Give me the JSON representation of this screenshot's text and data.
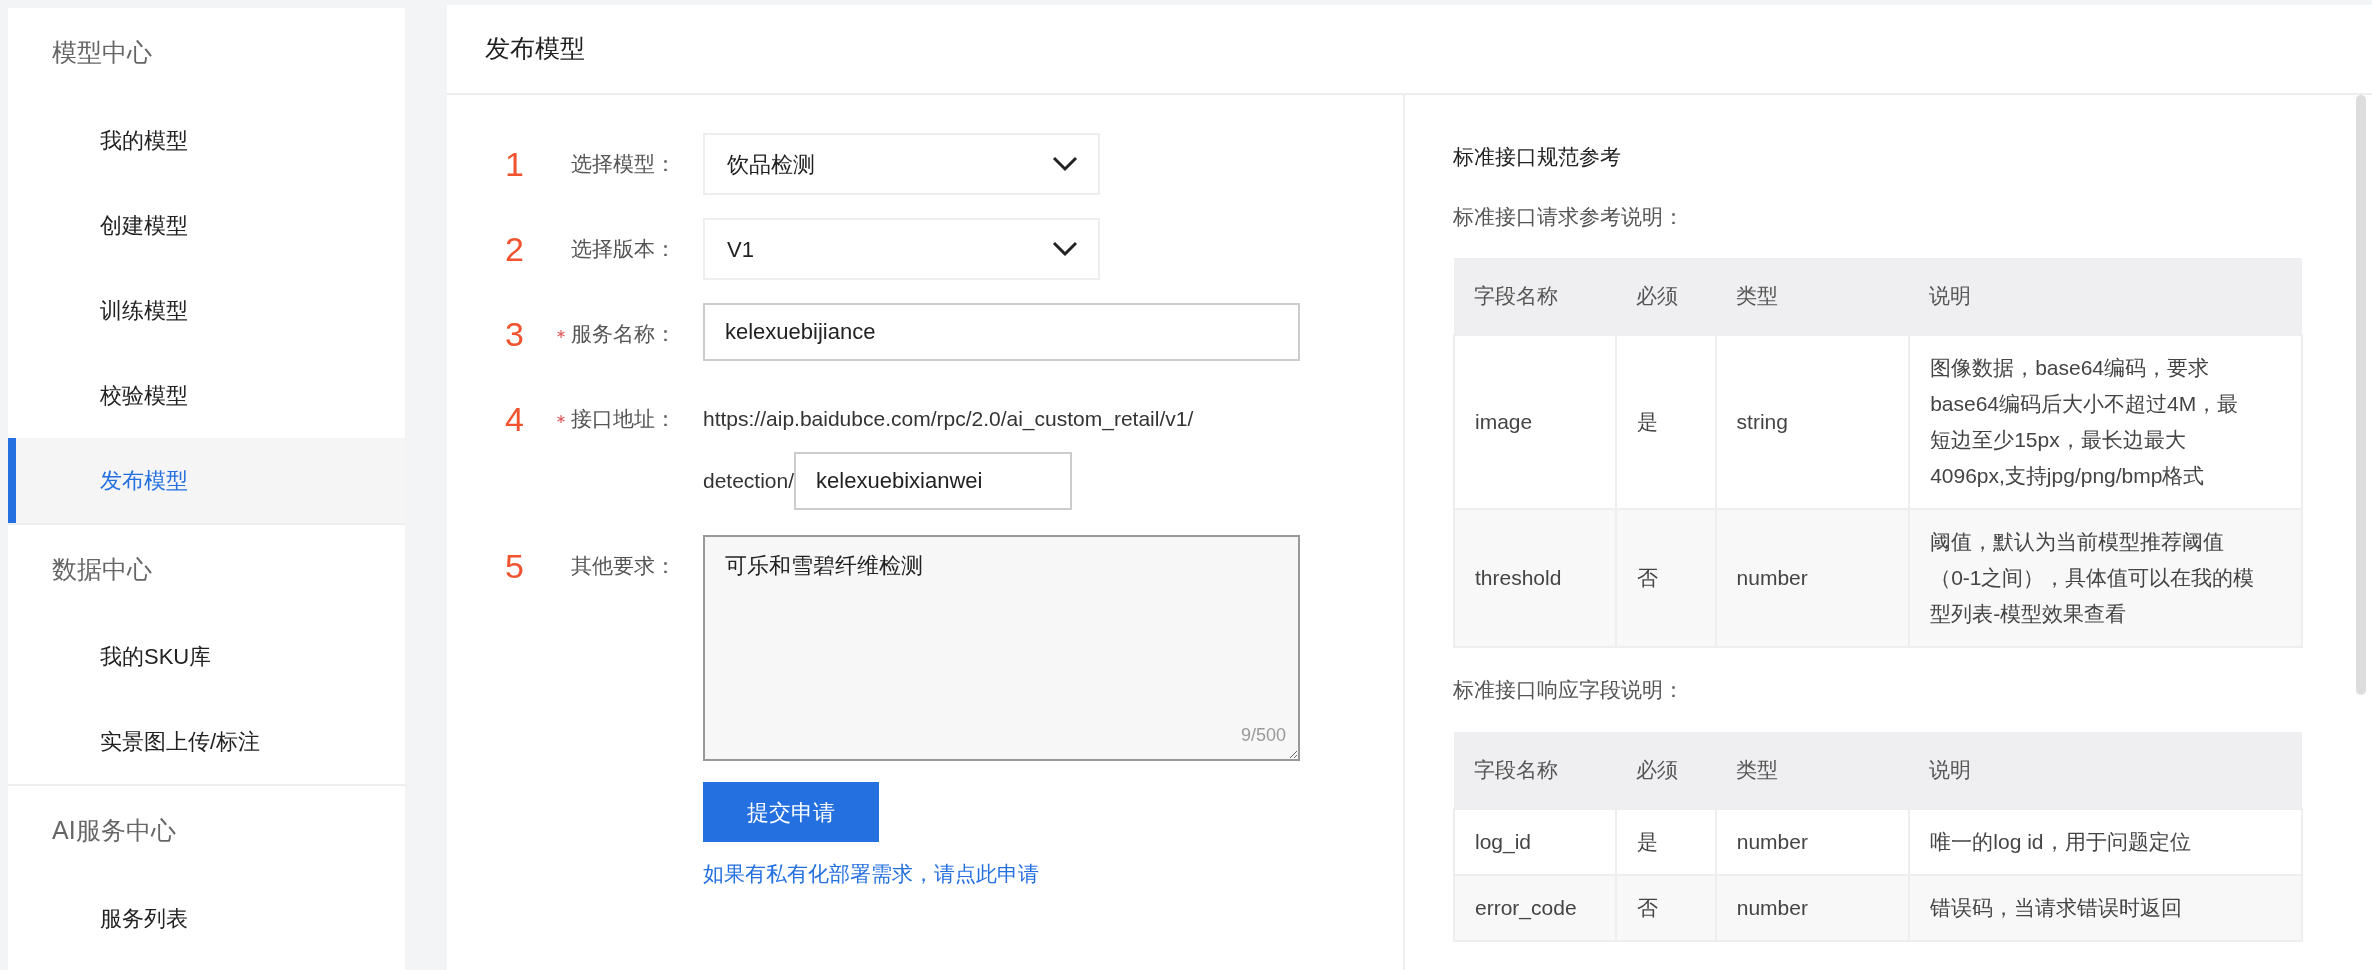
{
  "sidebar": {
    "groups": [
      {
        "title": "模型中心",
        "items": [
          {
            "label": "我的模型",
            "selected": false
          },
          {
            "label": "创建模型",
            "selected": false
          },
          {
            "label": "训练模型",
            "selected": false
          },
          {
            "label": "校验模型",
            "selected": false
          },
          {
            "label": "发布模型",
            "selected": true
          }
        ]
      },
      {
        "title": "数据中心",
        "items": [
          {
            "label": "我的SKU库",
            "selected": false
          },
          {
            "label": "实景图上传/标注",
            "selected": false
          }
        ]
      },
      {
        "title": "AI服务中心",
        "items": [
          {
            "label": "服务列表",
            "selected": false
          }
        ]
      }
    ]
  },
  "main": {
    "title": "发布模型",
    "form": {
      "fields": [
        {
          "kind": "select",
          "step": "1",
          "label": "选择模型：",
          "required": false,
          "value": "饮品检测"
        },
        {
          "kind": "select",
          "step": "2",
          "label": "选择版本：",
          "required": false,
          "value": "V1"
        },
        {
          "kind": "input",
          "step": "3",
          "label": "服务名称：",
          "required": true,
          "value": "kelexuebijiance"
        },
        {
          "kind": "address",
          "step": "4",
          "label": "接口地址：",
          "required": true,
          "url_line": "https://aip.baidubce.com/rpc/2.0/ai_custom_retail/v1/",
          "url_prefix": "detection/",
          "value": "kelexuebixianwei"
        },
        {
          "kind": "textarea",
          "step": "5",
          "label": "其他要求：",
          "required": false,
          "value": "可乐和雪碧纤维检测",
          "counter": "9/500"
        }
      ],
      "submit_button": "提交申请",
      "private_link": "如果有私有化部署需求，请点此申请"
    },
    "reference": {
      "title": "标准接口规范参考",
      "tables": [
        {
          "caption": "标准接口请求参考说明：",
          "columns": [
            "字段名称",
            "必须",
            "类型",
            "说明"
          ],
          "rows": [
            [
              "image",
              "是",
              "string",
              "图像数据，base64编码，要求base64编码后大小不超过4M，最短边至少15px，最长边最大4096px,支持jpg/png/bmp格式"
            ],
            [
              "threshold",
              "否",
              "number",
              "阈值，默认为当前模型推荐阈值（0-1之间），具体值可以在我的模型列表-模型效果查看"
            ]
          ]
        },
        {
          "caption": "标准接口响应字段说明：",
          "columns": [
            "字段名称",
            "必须",
            "类型",
            "说明"
          ],
          "rows": [
            [
              "log_id",
              "是",
              "number",
              "唯一的log id，用于问题定位"
            ],
            [
              "error_code",
              "否",
              "number",
              "错误码，当请求错误时返回"
            ]
          ]
        }
      ]
    }
  }
}
